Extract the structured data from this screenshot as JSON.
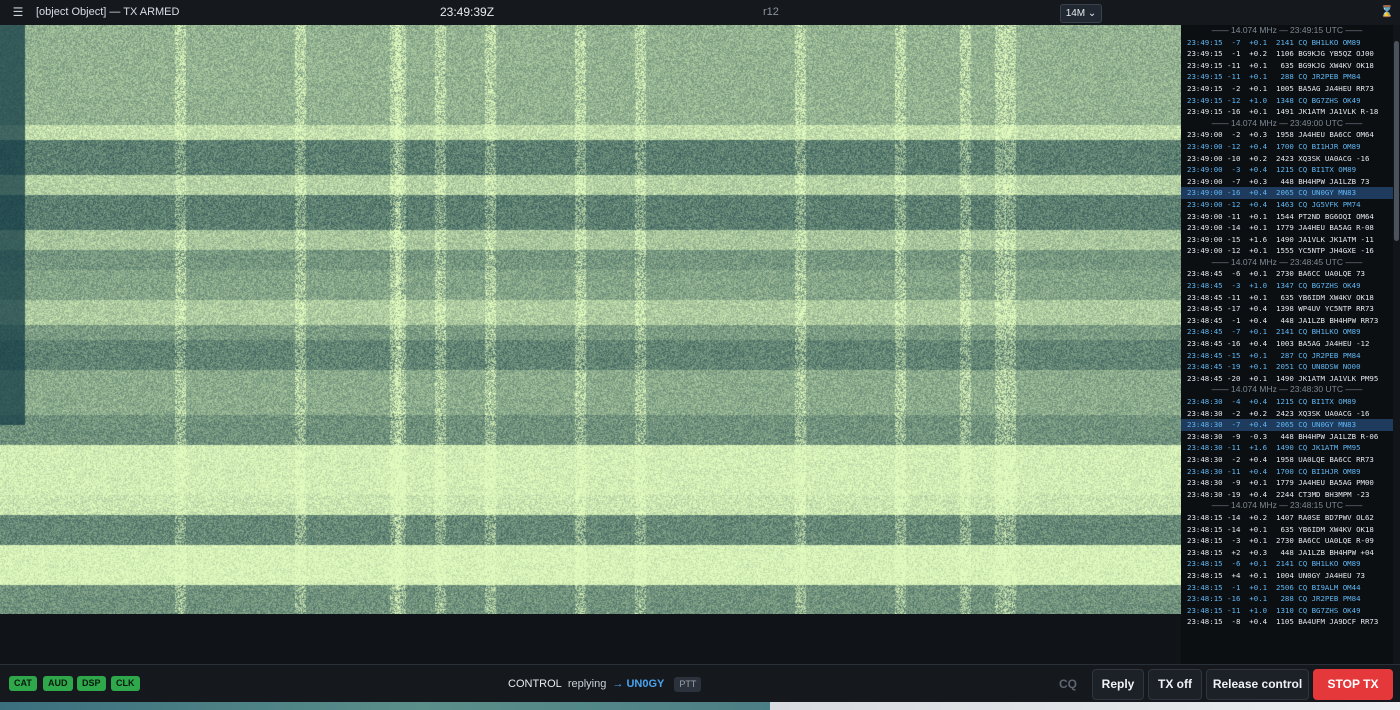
{
  "topbar": {
    "title": "[object Object] — TX ARMED",
    "clock": "23:49:39Z",
    "revision": "r12",
    "band_value": "14M",
    "band_chevron": "⌄"
  },
  "icons": {
    "menu": "menu-icon",
    "hourglass": "hourglass-icon",
    "chevron": "chevron-down-icon"
  },
  "colors": {
    "cq": "#5fb5f0",
    "selected_row": "#1e3a5c",
    "status_ok": "#2ea84a",
    "stop": "#e5383b",
    "target": "#4aa3ef"
  },
  "log": {
    "headers": [
      "—— 14.074 MHz — 23:49:15 UTC ——",
      "—— 14.074 MHz — 23:49:00 UTC ——",
      "—— 14.074 MHz — 23:48:45 UTC ——",
      "—— 14.074 MHz — 23:48:30 UTC ——",
      "—— 14.074 MHz — 23:48:15 UTC ——"
    ],
    "rows": [
      {
        "g": 0,
        "text": "23:49:15  -7  +0.1  2141 CQ BH1LKO OM89",
        "cq": true
      },
      {
        "g": 0,
        "text": "23:49:15  -1  +0.2  1106 BG9KJG YB5QZ OJ00",
        "cq": false
      },
      {
        "g": 0,
        "text": "23:49:15 -11  +0.1   635 BG9KJG XW4KV OK18",
        "cq": false
      },
      {
        "g": 0,
        "text": "23:49:15 -11  +0.1   288 CQ JR2PEB PM84",
        "cq": true
      },
      {
        "g": 0,
        "text": "23:49:15  -2  +0.1  1005 BA5AG JA4HEU RR73",
        "cq": false
      },
      {
        "g": 0,
        "text": "23:49:15 -12  +1.0  1348 CQ BG7ZHS OK49",
        "cq": true
      },
      {
        "g": 0,
        "text": "23:49:15 -16  +0.1  1491 JK1ATM JA1VLK R-18",
        "cq": false
      },
      {
        "g": 1,
        "text": "23:49:00  -2  +0.3  1958 JA4HEU BA6CC OM64",
        "cq": false
      },
      {
        "g": 1,
        "text": "23:49:00 -12  +0.4  1700 CQ BI1HJR OM89",
        "cq": true
      },
      {
        "g": 1,
        "text": "23:49:00 -10  +0.2  2423 XQ3SK UA0ACG -16",
        "cq": false
      },
      {
        "g": 1,
        "text": "23:49:00  -3  +0.4  1215 CQ BI1TX OM89",
        "cq": true
      },
      {
        "g": 1,
        "text": "23:49:00  -7  +0.3   448 BH4HPW JA1LZB 73",
        "cq": false
      },
      {
        "g": 1,
        "text": "23:49:00 -16  +0.4  2065 CQ UN0GY MN83",
        "cq": true,
        "sel": true
      },
      {
        "g": 1,
        "text": "23:49:00 -12  +0.4  1463 CQ JG5VFK PM74",
        "cq": true
      },
      {
        "g": 1,
        "text": "23:49:00 -11  +0.1  1544 PT2ND BG6OQI OM64",
        "cq": false
      },
      {
        "g": 1,
        "text": "23:49:00 -14  +0.1  1779 JA4HEU BA5AG R-08",
        "cq": false
      },
      {
        "g": 1,
        "text": "23:49:00 -15  +1.6  1490 JA1VLK JK1ATM -11",
        "cq": false
      },
      {
        "g": 1,
        "text": "23:49:00 -12  +0.1  1555 YC5NTP JH4GXE -16",
        "cq": false
      },
      {
        "g": 2,
        "text": "23:48:45  -6  +0.1  2730 BA6CC UA0LQE 73",
        "cq": false
      },
      {
        "g": 2,
        "text": "23:48:45  -3  +1.0  1347 CQ BG7ZHS OK49",
        "cq": true
      },
      {
        "g": 2,
        "text": "23:48:45 -11  +0.1   635 YB6IDM XW4KV OK18",
        "cq": false
      },
      {
        "g": 2,
        "text": "23:48:45 -17  +0.4  1398 WP4UV YC5NTP RR73",
        "cq": false
      },
      {
        "g": 2,
        "text": "23:48:45  -1  +0.4   448 JA1LZB BH4HPW RR73",
        "cq": false
      },
      {
        "g": 2,
        "text": "23:48:45  -7  +0.1  2141 CQ BH1LKO OM89",
        "cq": true
      },
      {
        "g": 2,
        "text": "23:48:45 -16  +0.4  1003 BA5AG JA4HEU -12",
        "cq": false
      },
      {
        "g": 2,
        "text": "23:48:45 -15  +0.1   287 CQ JR2PEB PM84",
        "cq": true
      },
      {
        "g": 2,
        "text": "23:48:45 -19  +0.1  2051 CQ UN8DSW NO00",
        "cq": true
      },
      {
        "g": 2,
        "text": "23:48:45 -20  +0.1  1490 JK1ATM JA1VLK PM95",
        "cq": false
      },
      {
        "g": 3,
        "text": "23:48:30  -4  +0.4  1215 CQ BI1TX OM89",
        "cq": true
      },
      {
        "g": 3,
        "text": "23:48:30  -2  +0.2  2423 XQ3SK UA0ACG -16",
        "cq": false
      },
      {
        "g": 3,
        "text": "23:48:30  -7  +0.4  2065 CQ UN0GY MN83",
        "cq": true,
        "sel": true
      },
      {
        "g": 3,
        "text": "23:48:30  -9  -0.3   448 BH4HPW JA1LZB R-06",
        "cq": false
      },
      {
        "g": 3,
        "text": "23:48:30 -11  +1.6  1490 CQ JK1ATM PM95",
        "cq": true
      },
      {
        "g": 3,
        "text": "23:48:30  -2  +0.4  1958 UA0LQE BA6CC RR73",
        "cq": false
      },
      {
        "g": 3,
        "text": "23:48:30 -11  +0.4  1700 CQ BI1HJR OM89",
        "cq": true
      },
      {
        "g": 3,
        "text": "23:48:30  -9  +0.1  1779 JA4HEU BA5AG PM00",
        "cq": false
      },
      {
        "g": 3,
        "text": "23:48:30 -19  +0.4  2244 CT3MD BH3MPM -23",
        "cq": false
      },
      {
        "g": 4,
        "text": "23:48:15 -14  +0.2  1407 RA0SE BD7PWV OL62",
        "cq": false
      },
      {
        "g": 4,
        "text": "23:48:15 -14  +0.1   635 YB6IDM XW4KV OK18",
        "cq": false
      },
      {
        "g": 4,
        "text": "23:48:15  -3  +0.1  2730 BA6CC UA0LQE R-09",
        "cq": false
      },
      {
        "g": 4,
        "text": "23:48:15  +2  +0.3   448 JA1LZB BH4HPW +04",
        "cq": false
      },
      {
        "g": 4,
        "text": "23:48:15  -6  +0.1  2141 CQ BH1LKO OM89",
        "cq": true
      },
      {
        "g": 4,
        "text": "23:48:15  +4  +0.1  1004 UN0GY JA4HEU 73",
        "cq": false
      },
      {
        "g": 4,
        "text": "23:48:15  -1  +0.1  2506 CQ BI9ALM OM44",
        "cq": true
      },
      {
        "g": 4,
        "text": "23:48:15 -16  +0.1   288 CQ JR2PEB PM84",
        "cq": true
      },
      {
        "g": 4,
        "text": "23:48:15 -11  +1.0  1310 CQ BG7ZHS OK49",
        "cq": true
      },
      {
        "g": 4,
        "text": "23:48:15  -8  +0.4  1105 BA4UFM JA9DCF RR73",
        "cq": false
      }
    ]
  },
  "status": {
    "cat": "CAT",
    "aud": "AUD",
    "dsp": "DSP",
    "clk": "CLK"
  },
  "control": {
    "label": "CONTROL",
    "replying": "replying",
    "arrow": "→",
    "target": "UN0GY",
    "ptt": "PTT"
  },
  "buttons": {
    "cq": "CQ",
    "reply": "Reply",
    "tx_off": "TX off",
    "release": "Release control",
    "stop": "STOP TX"
  }
}
